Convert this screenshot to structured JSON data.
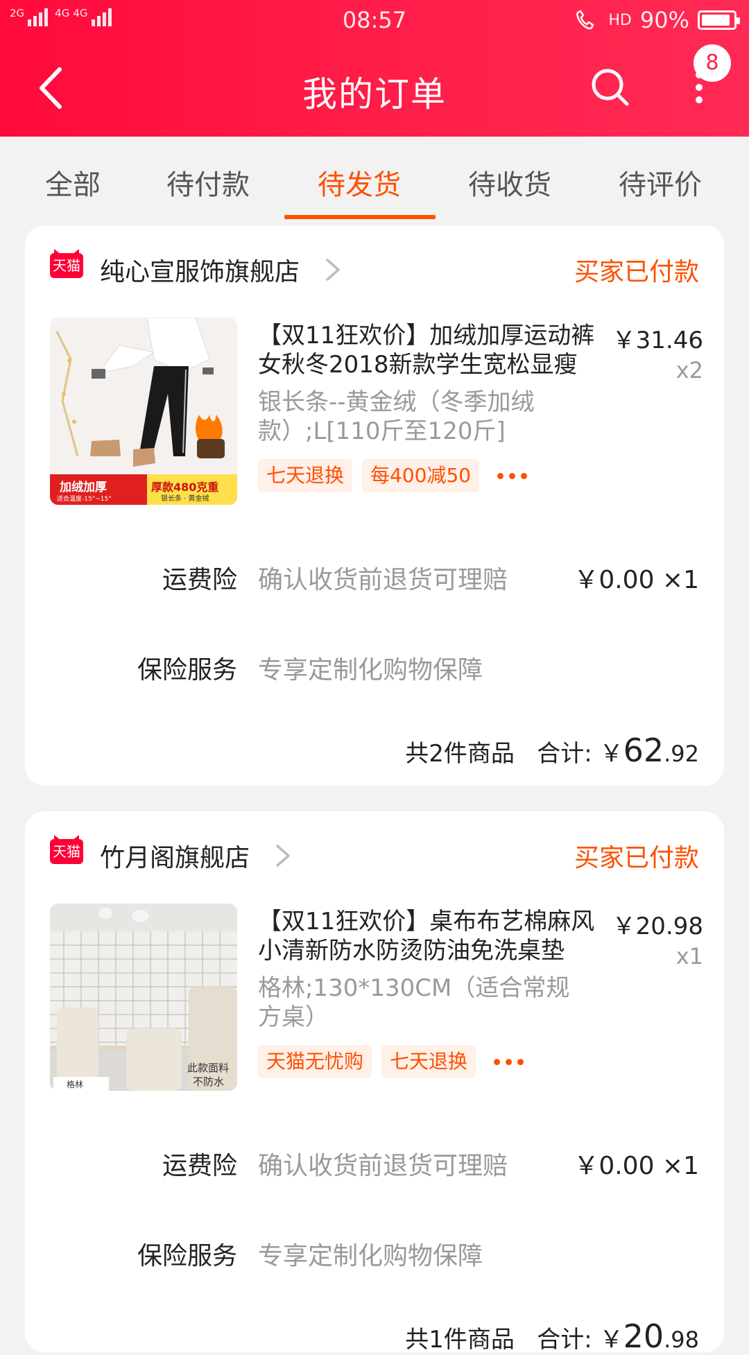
{
  "status_bar": {
    "signal_1": "2G",
    "signal_2": "4G",
    "signal_3": "4G",
    "time": "08:57",
    "hd": "HD",
    "battery": "90%",
    "battery_level": 0.9
  },
  "header": {
    "title": "我的订单",
    "badge_count": "8"
  },
  "tabs": [
    {
      "label": "全部"
    },
    {
      "label": "待付款"
    },
    {
      "label": "待发货",
      "active": true
    },
    {
      "label": "待收货"
    },
    {
      "label": "待评价"
    }
  ],
  "orders": [
    {
      "logo": "天猫",
      "shop": "纯心宣服饰旗舰店",
      "status": "买家已付款",
      "title": "【双11狂欢价】加绒加厚运动裤女秋冬2018新款学生宽松显瘦",
      "price": "￥31.46",
      "qty": "x2",
      "sku": "银长条--黄金绒（冬季加绒款）;L[110斤至120斤]",
      "tags": [
        "七天退换",
        "每400减50"
      ],
      "thumb_text_1": "加绒加厚",
      "thumb_text_2": "厚款480克重",
      "thumb_text_3": "适合温度-15°~15°",
      "thumb_text_4": "银长条 · 黄金绒",
      "freight_label": "运费险",
      "freight_desc": "确认收货前退货可理赔",
      "freight_price": "￥0.00 ×1",
      "insurance_label": "保险服务",
      "insurance_desc": "专享定制化购物保障",
      "summary_count": "共2件商品",
      "summary_label": "合计: ",
      "summary_currency": "￥",
      "summary_int": "62",
      "summary_dec": ".92"
    },
    {
      "logo": "天猫",
      "shop": "竹月阁旗舰店",
      "status": "买家已付款",
      "title": "【双11狂欢价】桌布布艺棉麻风小清新防水防烫防油免洗桌垫",
      "price": "￥20.98",
      "qty": "x1",
      "sku": "格林;130*130CM（适合常规方桌）",
      "tags": [
        "天猫无忧购",
        "七天退换"
      ],
      "thumb_text_1": "格林",
      "thumb_text_2": "此款面料",
      "thumb_text_3": "不防水",
      "freight_label": "运费险",
      "freight_desc": "确认收货前退货可理赔",
      "freight_price": "￥0.00 ×1",
      "insurance_label": "保险服务",
      "insurance_desc": "专享定制化购物保障",
      "summary_count": "共1件商品",
      "summary_label": "合计: ",
      "summary_currency": "￥",
      "summary_int": "20",
      "summary_dec": ".98"
    }
  ]
}
